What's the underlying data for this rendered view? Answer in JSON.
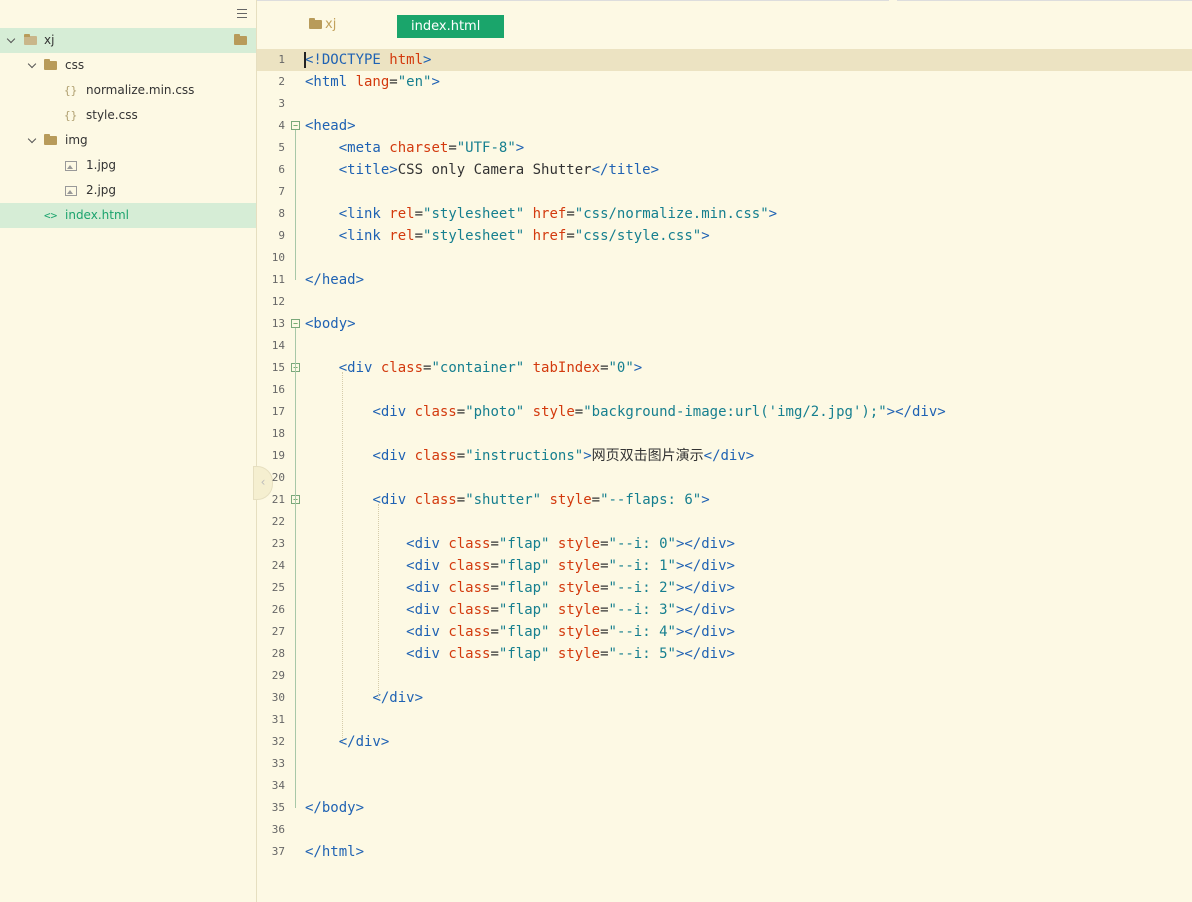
{
  "sidebar": {
    "items": [
      {
        "label": "xj",
        "type": "folder",
        "expanded": true,
        "selected": true
      },
      {
        "label": "css",
        "type": "folder",
        "expanded": true
      },
      {
        "label": "normalize.min.css",
        "type": "css-file"
      },
      {
        "label": "style.css",
        "type": "css-file"
      },
      {
        "label": "img",
        "type": "folder",
        "expanded": true
      },
      {
        "label": "1.jpg",
        "type": "image-file"
      },
      {
        "label": "2.jpg",
        "type": "image-file"
      },
      {
        "label": "index.html",
        "type": "html-file",
        "active": true
      }
    ]
  },
  "header": {
    "breadcrumb": "xj",
    "active_tab": "index.html"
  },
  "colors": {
    "background": "#fdf9e4",
    "accent": "#1aa56b",
    "tag": "#1f62b3",
    "attribute": "#d33a0e",
    "string": "#167f8f"
  },
  "editor": {
    "current_line": 1,
    "lines": [
      [
        [
          "tg",
          "<!DOCTYPE "
        ],
        [
          "at",
          "html"
        ],
        [
          "tg",
          ">"
        ]
      ],
      [
        [
          "tg",
          "<html "
        ],
        [
          "at",
          "lang"
        ],
        [
          "tx",
          "="
        ],
        [
          "st",
          "\"en\""
        ],
        [
          "tg",
          ">"
        ]
      ],
      [],
      [
        [
          "tg",
          "<head>"
        ]
      ],
      [
        [
          "tx",
          "    "
        ],
        [
          "tg",
          "<meta "
        ],
        [
          "at",
          "charset"
        ],
        [
          "tx",
          "="
        ],
        [
          "st",
          "\"UTF-8\""
        ],
        [
          "tg",
          ">"
        ]
      ],
      [
        [
          "tx",
          "    "
        ],
        [
          "tg",
          "<title>"
        ],
        [
          "tx",
          "CSS only Camera Shutter"
        ],
        [
          "tg",
          "</title>"
        ]
      ],
      [],
      [
        [
          "tx",
          "    "
        ],
        [
          "tg",
          "<link "
        ],
        [
          "at",
          "rel"
        ],
        [
          "tx",
          "="
        ],
        [
          "st",
          "\"stylesheet\""
        ],
        [
          "tx",
          " "
        ],
        [
          "at",
          "href"
        ],
        [
          "tx",
          "="
        ],
        [
          "st",
          "\"css/normalize.min.css\""
        ],
        [
          "tg",
          ">"
        ]
      ],
      [
        [
          "tx",
          "    "
        ],
        [
          "tg",
          "<link "
        ],
        [
          "at",
          "rel"
        ],
        [
          "tx",
          "="
        ],
        [
          "st",
          "\"stylesheet\""
        ],
        [
          "tx",
          " "
        ],
        [
          "at",
          "href"
        ],
        [
          "tx",
          "="
        ],
        [
          "st",
          "\"css/style.css\""
        ],
        [
          "tg",
          ">"
        ]
      ],
      [],
      [
        [
          "tg",
          "</head>"
        ]
      ],
      [],
      [
        [
          "tg",
          "<body>"
        ]
      ],
      [],
      [
        [
          "tx",
          "    "
        ],
        [
          "tg",
          "<div "
        ],
        [
          "at",
          "class"
        ],
        [
          "tx",
          "="
        ],
        [
          "st",
          "\"container\""
        ],
        [
          "tx",
          " "
        ],
        [
          "at",
          "tabIndex"
        ],
        [
          "tx",
          "="
        ],
        [
          "st",
          "\"0\""
        ],
        [
          "tg",
          ">"
        ]
      ],
      [],
      [
        [
          "tx",
          "        "
        ],
        [
          "tg",
          "<div "
        ],
        [
          "at",
          "class"
        ],
        [
          "tx",
          "="
        ],
        [
          "st",
          "\"photo\""
        ],
        [
          "tx",
          " "
        ],
        [
          "at",
          "style"
        ],
        [
          "tx",
          "="
        ],
        [
          "st",
          "\"background-image:url('img/2.jpg');\""
        ],
        [
          "tg",
          "></div>"
        ]
      ],
      [],
      [
        [
          "tx",
          "        "
        ],
        [
          "tg",
          "<div "
        ],
        [
          "at",
          "class"
        ],
        [
          "tx",
          "="
        ],
        [
          "st",
          "\"instructions\""
        ],
        [
          "tg",
          ">"
        ],
        [
          "tx",
          "网页双击图片演示"
        ],
        [
          "tg",
          "</div>"
        ]
      ],
      [],
      [
        [
          "tx",
          "        "
        ],
        [
          "tg",
          "<div "
        ],
        [
          "at",
          "class"
        ],
        [
          "tx",
          "="
        ],
        [
          "st",
          "\"shutter\""
        ],
        [
          "tx",
          " "
        ],
        [
          "at",
          "style"
        ],
        [
          "tx",
          "="
        ],
        [
          "st",
          "\"--flaps: 6\""
        ],
        [
          "tg",
          ">"
        ]
      ],
      [],
      [
        [
          "tx",
          "            "
        ],
        [
          "tg",
          "<div "
        ],
        [
          "at",
          "class"
        ],
        [
          "tx",
          "="
        ],
        [
          "st",
          "\"flap\""
        ],
        [
          "tx",
          " "
        ],
        [
          "at",
          "style"
        ],
        [
          "tx",
          "="
        ],
        [
          "st",
          "\"--i: 0\""
        ],
        [
          "tg",
          "></div>"
        ]
      ],
      [
        [
          "tx",
          "            "
        ],
        [
          "tg",
          "<div "
        ],
        [
          "at",
          "class"
        ],
        [
          "tx",
          "="
        ],
        [
          "st",
          "\"flap\""
        ],
        [
          "tx",
          " "
        ],
        [
          "at",
          "style"
        ],
        [
          "tx",
          "="
        ],
        [
          "st",
          "\"--i: 1\""
        ],
        [
          "tg",
          "></div>"
        ]
      ],
      [
        [
          "tx",
          "            "
        ],
        [
          "tg",
          "<div "
        ],
        [
          "at",
          "class"
        ],
        [
          "tx",
          "="
        ],
        [
          "st",
          "\"flap\""
        ],
        [
          "tx",
          " "
        ],
        [
          "at",
          "style"
        ],
        [
          "tx",
          "="
        ],
        [
          "st",
          "\"--i: 2\""
        ],
        [
          "tg",
          "></div>"
        ]
      ],
      [
        [
          "tx",
          "            "
        ],
        [
          "tg",
          "<div "
        ],
        [
          "at",
          "class"
        ],
        [
          "tx",
          "="
        ],
        [
          "st",
          "\"flap\""
        ],
        [
          "tx",
          " "
        ],
        [
          "at",
          "style"
        ],
        [
          "tx",
          "="
        ],
        [
          "st",
          "\"--i: 3\""
        ],
        [
          "tg",
          "></div>"
        ]
      ],
      [
        [
          "tx",
          "            "
        ],
        [
          "tg",
          "<div "
        ],
        [
          "at",
          "class"
        ],
        [
          "tx",
          "="
        ],
        [
          "st",
          "\"flap\""
        ],
        [
          "tx",
          " "
        ],
        [
          "at",
          "style"
        ],
        [
          "tx",
          "="
        ],
        [
          "st",
          "\"--i: 4\""
        ],
        [
          "tg",
          "></div>"
        ]
      ],
      [
        [
          "tx",
          "            "
        ],
        [
          "tg",
          "<div "
        ],
        [
          "at",
          "class"
        ],
        [
          "tx",
          "="
        ],
        [
          "st",
          "\"flap\""
        ],
        [
          "tx",
          " "
        ],
        [
          "at",
          "style"
        ],
        [
          "tx",
          "="
        ],
        [
          "st",
          "\"--i: 5\""
        ],
        [
          "tg",
          "></div>"
        ]
      ],
      [],
      [
        [
          "tx",
          "        "
        ],
        [
          "tg",
          "</div>"
        ]
      ],
      [],
      [
        [
          "tx",
          "    "
        ],
        [
          "tg",
          "</div>"
        ]
      ],
      [],
      [],
      [
        [
          "tg",
          "</body>"
        ]
      ],
      [],
      [
        [
          "tg",
          "</html>"
        ]
      ]
    ],
    "fold_lines": [
      4,
      13,
      15,
      21
    ]
  }
}
